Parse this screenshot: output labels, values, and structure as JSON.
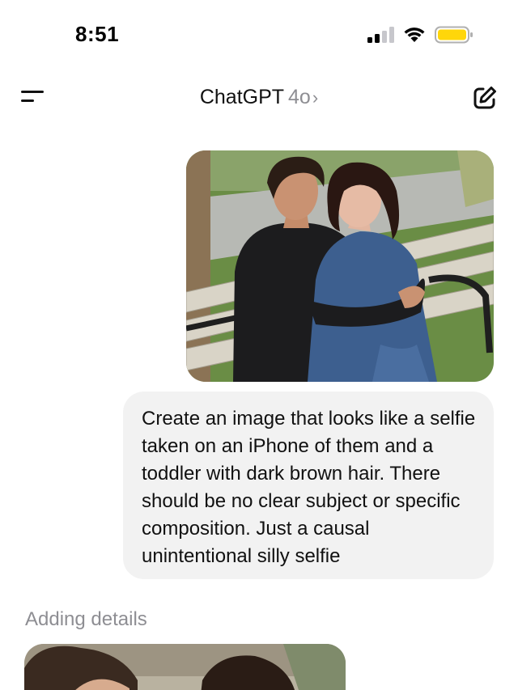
{
  "status_bar": {
    "time": "8:51",
    "signal_icon": "cellular-signal-2-bars",
    "wifi_icon": "wifi",
    "battery_icon": "battery-low-power-mode",
    "battery_color": "#ffd60a"
  },
  "header": {
    "menu_icon": "sidebar-menu",
    "app_name": "ChatGPT",
    "model_name": "4o",
    "chevron": "›",
    "compose_icon": "new-chat-pencil"
  },
  "conversation": {
    "user_image_description_icon": "attached-photo",
    "user_message": "Create an image that looks like a selfie taken on an iPhone of them and a toddler with dark brown hair. There should be no clear subject or specific composition. Just a causal unintentional silly selfie",
    "assistant_status": "Adding details"
  },
  "colors": {
    "bubble_bg": "#f2f2f2",
    "muted_text": "#8e8e93"
  }
}
